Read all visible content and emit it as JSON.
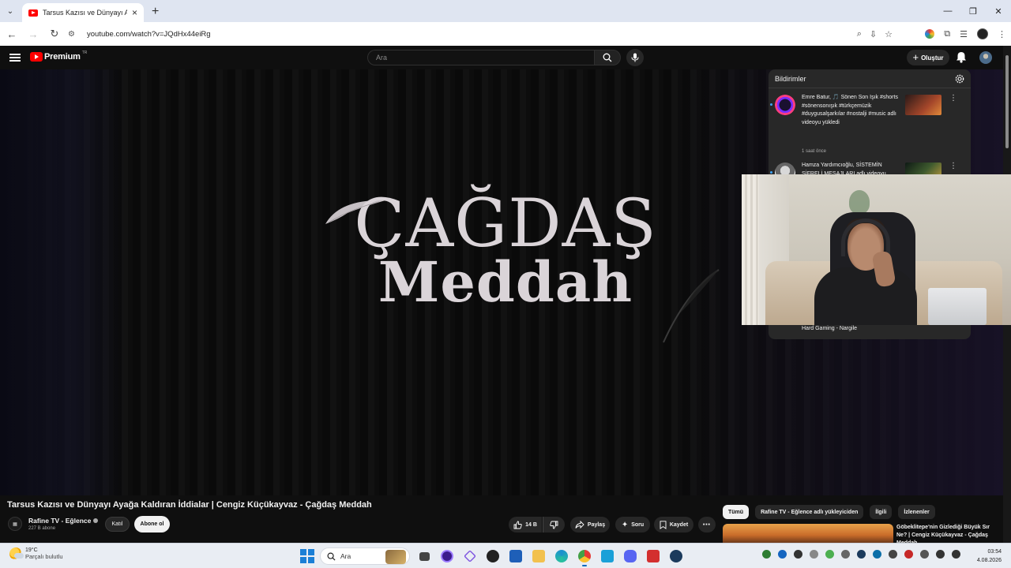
{
  "browser": {
    "tab_title": "Tarsus Kazısı ve Dünyayı Ayağa",
    "url": "youtube.com/watch?v=JQdHx44eiRg"
  },
  "youtube": {
    "logo_text": "Premium",
    "logo_region": "TR",
    "search_placeholder": "Ara",
    "create_label": "Oluştur"
  },
  "video": {
    "logo_line1": "ÇAĞDAŞ",
    "logo_line2": "Meddah",
    "title": "Tarsus Kazısı ve Dünyayı Ayağa Kaldıran İddialar | Cengiz Küçükayvaz - Çağdaş Meddah"
  },
  "notifications": {
    "header": "Bildirimler",
    "items": [
      {
        "text": "Emre Batur, 🎵 Sönen Son Işık #shorts #sönensonışık #türkçemüzik #duygusalşarkılar #nostalji #music adlı videoyu yükledi",
        "time": "1 saat önce"
      },
      {
        "text": "Hamza Yardımcıoğlu, SİSTEMİN ŞİFRELİ MESAJLARI adlı videoyu yükledi"
      },
      {
        "text": "Hard Gaming - Nargile"
      }
    ]
  },
  "channel": {
    "name": "Rafine TV - Eğlence",
    "subscribers": "227 B abone",
    "join_label": "Katıl",
    "subscribe_label": "Abone ol"
  },
  "actions": {
    "likes": "14 B",
    "share": "Paylaş",
    "ask": "Soru",
    "save": "Kaydet"
  },
  "chips": [
    "Tümü",
    "Rafine TV - Eğlence adlı yükleyiciden",
    "İlgili",
    "İzlenenler"
  ],
  "recommendation": {
    "title": "Göbeklitepe'nin Gizlediği Büyük Sır Ne? | Cengiz Küçükayvaz - Çağdaş Meddah"
  },
  "taskbar": {
    "temperature": "19°C",
    "weather": "Parçalı bulutlu",
    "search": "Ara",
    "time": "03:54",
    "date": "4.08.2026"
  },
  "colors": {
    "youtube_red": "#ff0000",
    "subscribe_bg": "#f1f1f1",
    "panel_bg": "#282828"
  }
}
